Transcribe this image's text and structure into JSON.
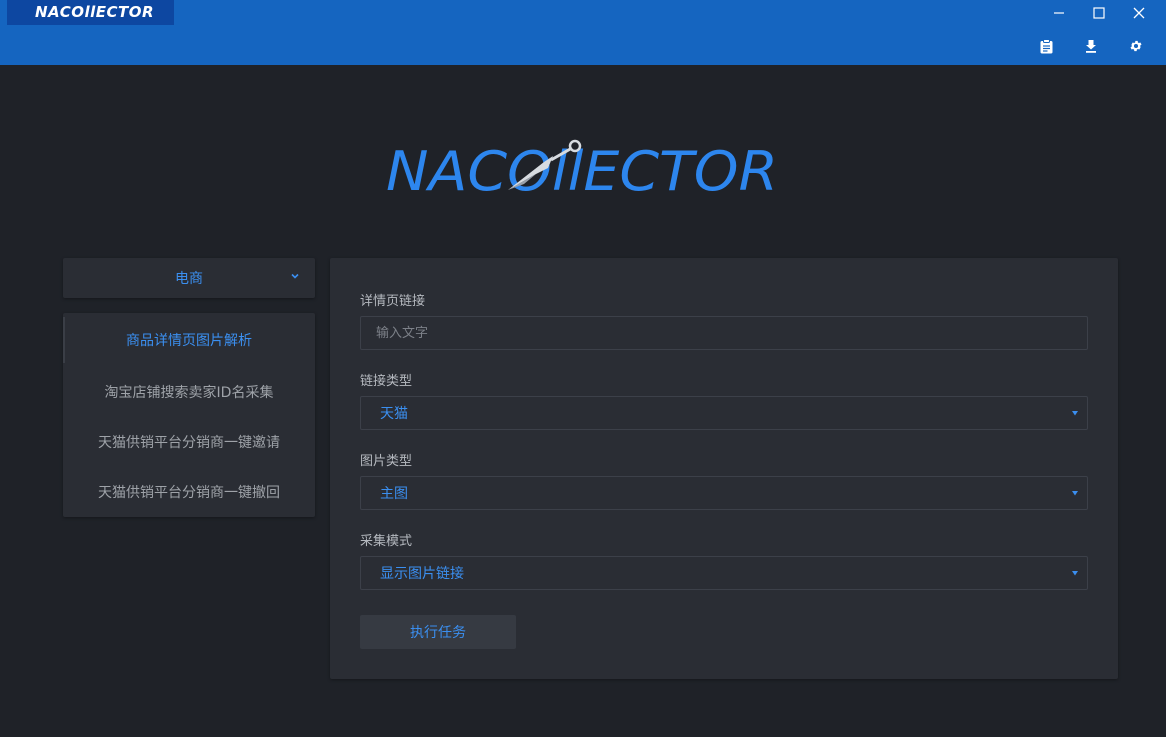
{
  "app": {
    "badge_title": "NACOllECTOR",
    "logo_text": "NACOllECTOR"
  },
  "window_controls": [
    "minimize-icon",
    "maximize-icon",
    "close-icon"
  ],
  "toolbar_icons": [
    "clipboard-icon",
    "download-icon",
    "gear-icon"
  ],
  "sidebar": {
    "category": "电商",
    "items": [
      {
        "label": "商品详情页图片解析",
        "active": true
      },
      {
        "label": "淘宝店铺搜索卖家ID名采集",
        "active": false
      },
      {
        "label": "天猫供销平台分销商一键邀请",
        "active": false
      },
      {
        "label": "天猫供销平台分销商一键撤回",
        "active": false
      }
    ]
  },
  "form": {
    "detail_link": {
      "label": "详情页链接",
      "placeholder": "输入文字",
      "value": ""
    },
    "link_type": {
      "label": "链接类型",
      "value": "天猫"
    },
    "image_type": {
      "label": "图片类型",
      "value": "主图"
    },
    "collect_mode": {
      "label": "采集模式",
      "value": "显示图片链接"
    },
    "submit_label": "执行任务"
  },
  "colors": {
    "titlebar": "#1565c0",
    "badge": "#0d47a1",
    "accent": "#3b8ff0",
    "background": "#1f2228",
    "panel": "#2a2d34"
  }
}
